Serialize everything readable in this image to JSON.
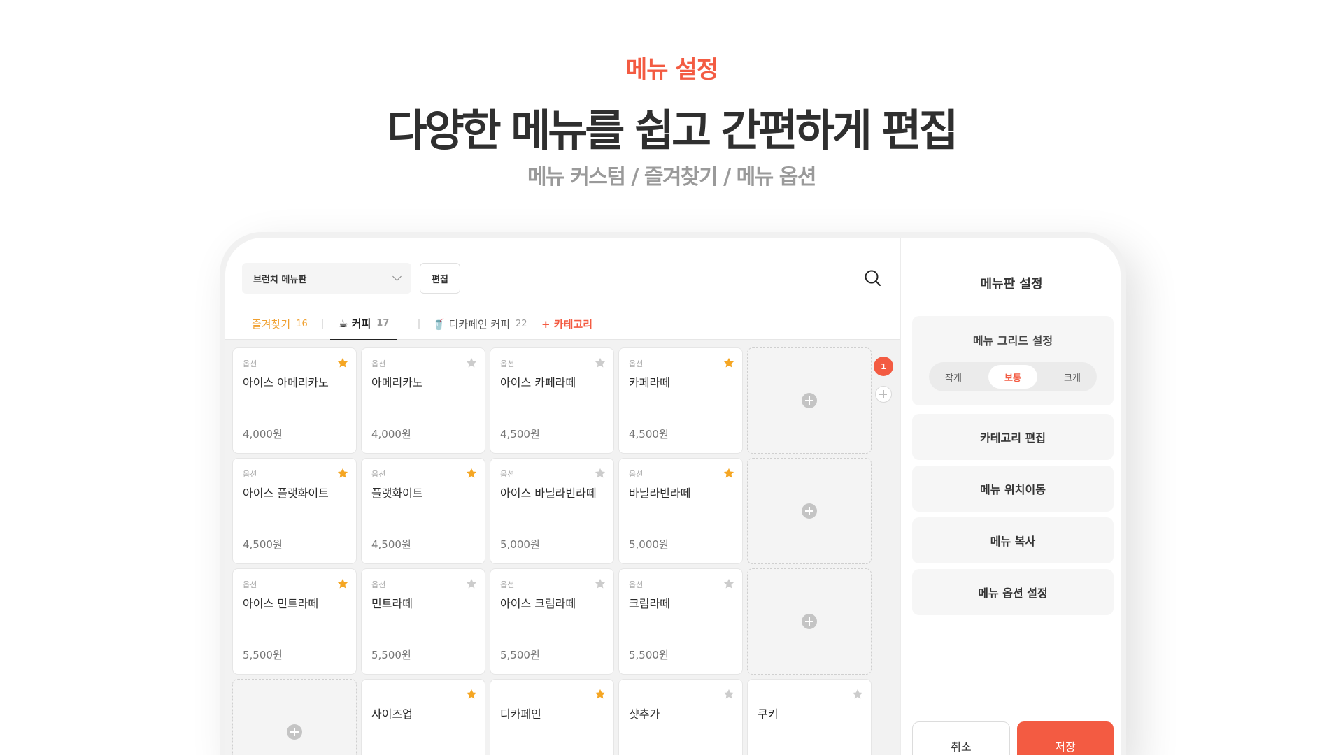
{
  "hero": {
    "eyebrow": "메뉴 설정",
    "headline": "다양한 메뉴를 쉽고 간편하게 편집",
    "subline": "메뉴 커스텀 / 즐겨찾기 / 메뉴 옵션"
  },
  "toolbar": {
    "board_name": "브런치 메뉴판",
    "edit_label": "편집",
    "search_icon": "search-icon"
  },
  "tabs": [
    {
      "label": "즐겨찾기",
      "count": "16"
    },
    {
      "label": "☕ 커피",
      "count": "17"
    },
    {
      "label": "🥤 디카페인 커피",
      "count": "22"
    },
    {
      "label": "+ 카테고리",
      "count": ""
    }
  ],
  "colors": {
    "accent": "#f35b42",
    "star_on": "#f5a623",
    "star_off": "#cccccc"
  },
  "menu_grid": {
    "option_label": "옵션",
    "rows": [
      [
        {
          "name": "아이스 아메리카노",
          "price": "4,000원",
          "fav": true
        },
        {
          "name": "아메리카노",
          "price": "4,000원",
          "fav": false
        },
        {
          "name": "아이스 카페라떼",
          "price": "4,500원",
          "fav": false
        },
        {
          "name": "카페라떼",
          "price": "4,500원",
          "fav": true
        },
        {
          "empty": true
        }
      ],
      [
        {
          "name": "아이스 플랫화이트",
          "price": "4,500원",
          "fav": true
        },
        {
          "name": "플랫화이트",
          "price": "4,500원",
          "fav": true
        },
        {
          "name": "아이스 바닐라빈라떼",
          "price": "5,000원",
          "fav": false
        },
        {
          "name": "바닐라빈라떼",
          "price": "5,000원",
          "fav": true
        },
        {
          "empty": true
        }
      ],
      [
        {
          "name": "아이스 민트라떼",
          "price": "5,500원",
          "fav": true
        },
        {
          "name": "민트라떼",
          "price": "5,500원",
          "fav": false
        },
        {
          "name": "아이스 크림라떼",
          "price": "5,500원",
          "fav": false
        },
        {
          "name": "크림라떼",
          "price": "5,500원",
          "fav": false
        },
        {
          "empty": true
        }
      ],
      [
        {
          "empty": true
        },
        {
          "name": "사이즈업",
          "price": "",
          "fav": true,
          "no_option": true
        },
        {
          "name": "디카페인",
          "price": "",
          "fav": true,
          "no_option": true
        },
        {
          "name": "샷추가",
          "price": "",
          "fav": false,
          "no_option": true
        },
        {
          "name": "쿠키",
          "price": "",
          "fav": false,
          "no_option": true
        }
      ]
    ]
  },
  "pages": {
    "current": "1"
  },
  "sidebar": {
    "title": "메뉴판 설정",
    "grid_setting_label": "메뉴 그리드 설정",
    "grid_sizes": [
      "작게",
      "보통",
      "크게"
    ],
    "grid_size_selected": "보통",
    "actions": [
      "카테고리 편집",
      "메뉴 위치이동",
      "메뉴 복사",
      "메뉴 옵션 설정"
    ],
    "cancel_label": "취소",
    "save_label": "저장"
  }
}
